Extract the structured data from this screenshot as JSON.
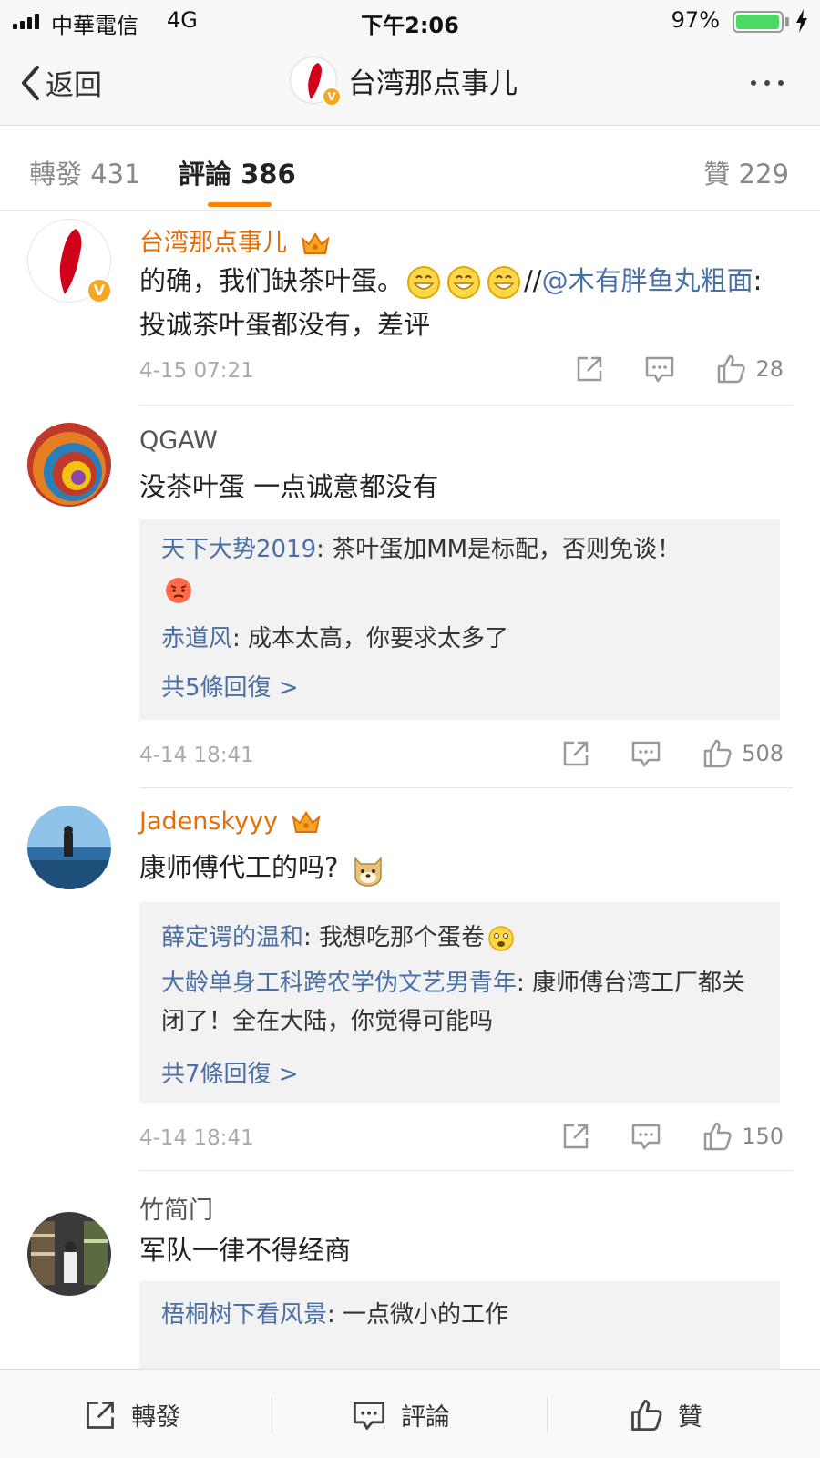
{
  "status_bar": {
    "carrier": "中華電信",
    "network": "4G",
    "time": "下午2:06",
    "battery_percent": "97%",
    "battery_level": 0.97
  },
  "nav": {
    "back_label": "返回",
    "title": "台湾那点事儿"
  },
  "tabs": {
    "repost": "轉發 431",
    "comments": "評論 386",
    "likes": "贊 229"
  },
  "comments": [
    {
      "author": "台湾那点事儿",
      "text": "的确，我们缺茶叶蛋。",
      "forward_prefix": "//",
      "mention": "@木有胖鱼丸粗面",
      "forward_text": ":投诚茶叶蛋都没有，差评",
      "time": "4-15 07:21",
      "likes": "28"
    },
    {
      "author": "QGAW",
      "text": "没茶叶蛋 一点诚意都没有",
      "replies": [
        {
          "name": "天下大势2019",
          "text": ": 茶叶蛋加MM是标配，否则免谈！"
        },
        {
          "name": "赤道风",
          "text": ": 成本太高，你要求太多了"
        }
      ],
      "more_replies": "共5條回復 >",
      "time": "4-14 18:41",
      "likes": "508"
    },
    {
      "author": "Jadenskyyy",
      "text": "康师傅代工的吗?",
      "replies": [
        {
          "name": "薛定谔的温和",
          "text": ": 我想吃那个蛋卷"
        },
        {
          "name": "大龄单身工科跨农学伪文艺男青年",
          "text": ": 康师傅台湾工厂都关闭了！全在大陆，你觉得可能吗"
        }
      ],
      "more_replies": "共7條回復 >",
      "time": "4-14 18:41",
      "likes": "150"
    },
    {
      "author": "竹简门",
      "text": "军队一律不得经商",
      "replies": [
        {
          "name": "梧桐树下看风景",
          "text": ": 一点微小的工作"
        }
      ]
    }
  ],
  "bottom_bar": {
    "repost": "轉發",
    "comment": "評論",
    "like": "贊"
  }
}
